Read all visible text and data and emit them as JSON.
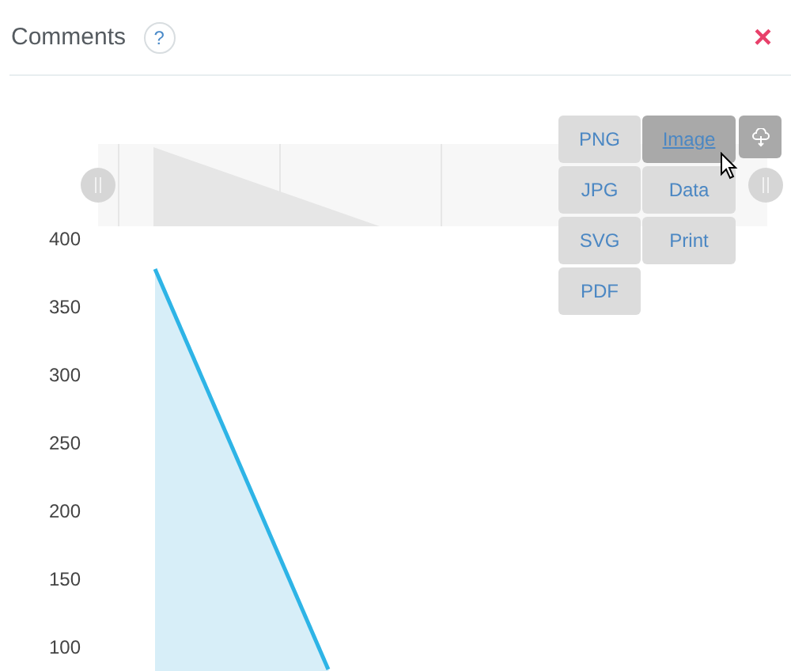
{
  "header": {
    "title": "Comments",
    "help": "?",
    "close": "×"
  },
  "chart": {
    "y_axis_labels": [
      "400",
      "350",
      "300",
      "250",
      "200",
      "150",
      "100"
    ]
  },
  "export_menu": {
    "formats": [
      {
        "label": "PNG",
        "selected": false
      },
      {
        "label": "JPG",
        "selected": false
      },
      {
        "label": "SVG",
        "selected": false
      },
      {
        "label": "PDF",
        "selected": false
      }
    ],
    "actions": [
      {
        "label": "Image",
        "selected": true
      },
      {
        "label": "Data",
        "selected": false
      },
      {
        "label": "Print",
        "selected": false
      }
    ]
  }
}
